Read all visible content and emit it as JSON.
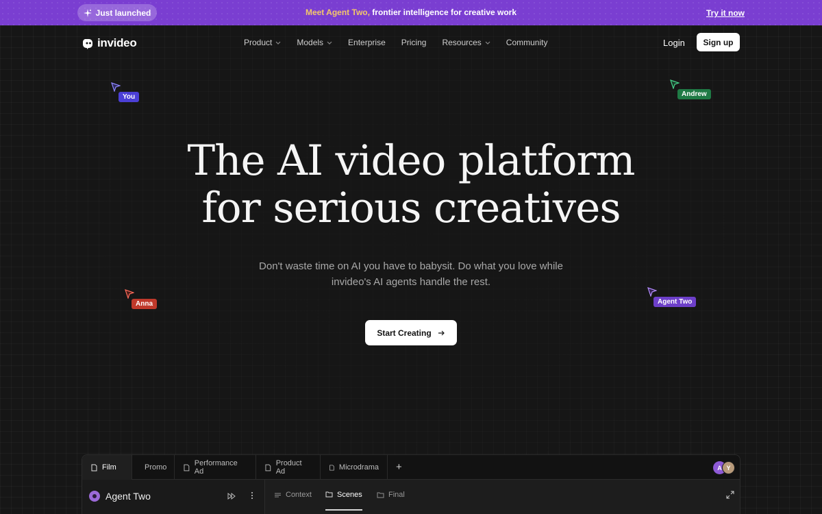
{
  "announcement": {
    "badge": "Just launched",
    "highlight": "Meet Agent Two,",
    "text": "frontier intelligence for creative work",
    "link": "Try it now",
    "bg_color": "#7a3ed1"
  },
  "nav": {
    "logo_text": "invideo",
    "items": [
      {
        "label": "Product",
        "dropdown": true
      },
      {
        "label": "Models",
        "dropdown": true
      },
      {
        "label": "Enterprise",
        "dropdown": false
      },
      {
        "label": "Pricing",
        "dropdown": false
      },
      {
        "label": "Resources",
        "dropdown": true
      },
      {
        "label": "Community",
        "dropdown": false
      }
    ],
    "login": "Login",
    "signup": "Sign up"
  },
  "cursors": [
    {
      "name": "You",
      "color": "#4b3fd6"
    },
    {
      "name": "Andrew",
      "color": "#1f7a45"
    },
    {
      "name": "Anna",
      "color": "#c0392b"
    },
    {
      "name": "Agent Two",
      "color": "#6d3fc9"
    }
  ],
  "hero": {
    "title_line1": "The AI video platform",
    "title_line2": "for serious creatives",
    "subtitle_line1": "Don't waste time on AI you have to babysit. Do what you love while",
    "subtitle_line2": "invideo's AI agents handle the rest.",
    "cta": "Start Creating"
  },
  "app_preview": {
    "tabs": [
      "Film",
      "Promo",
      "Performance Ad",
      "Product Ad",
      "Microdrama"
    ],
    "active_tab": "Film",
    "add_tab": "+",
    "avatars": [
      {
        "initial": "A",
        "color": "#8e5ad6"
      },
      {
        "initial": "Y",
        "color": "#b79a7a"
      }
    ],
    "agent_name": "Agent Two",
    "subtabs": [
      "Context",
      "Scenes",
      "Final"
    ],
    "active_subtab": "Scenes"
  }
}
